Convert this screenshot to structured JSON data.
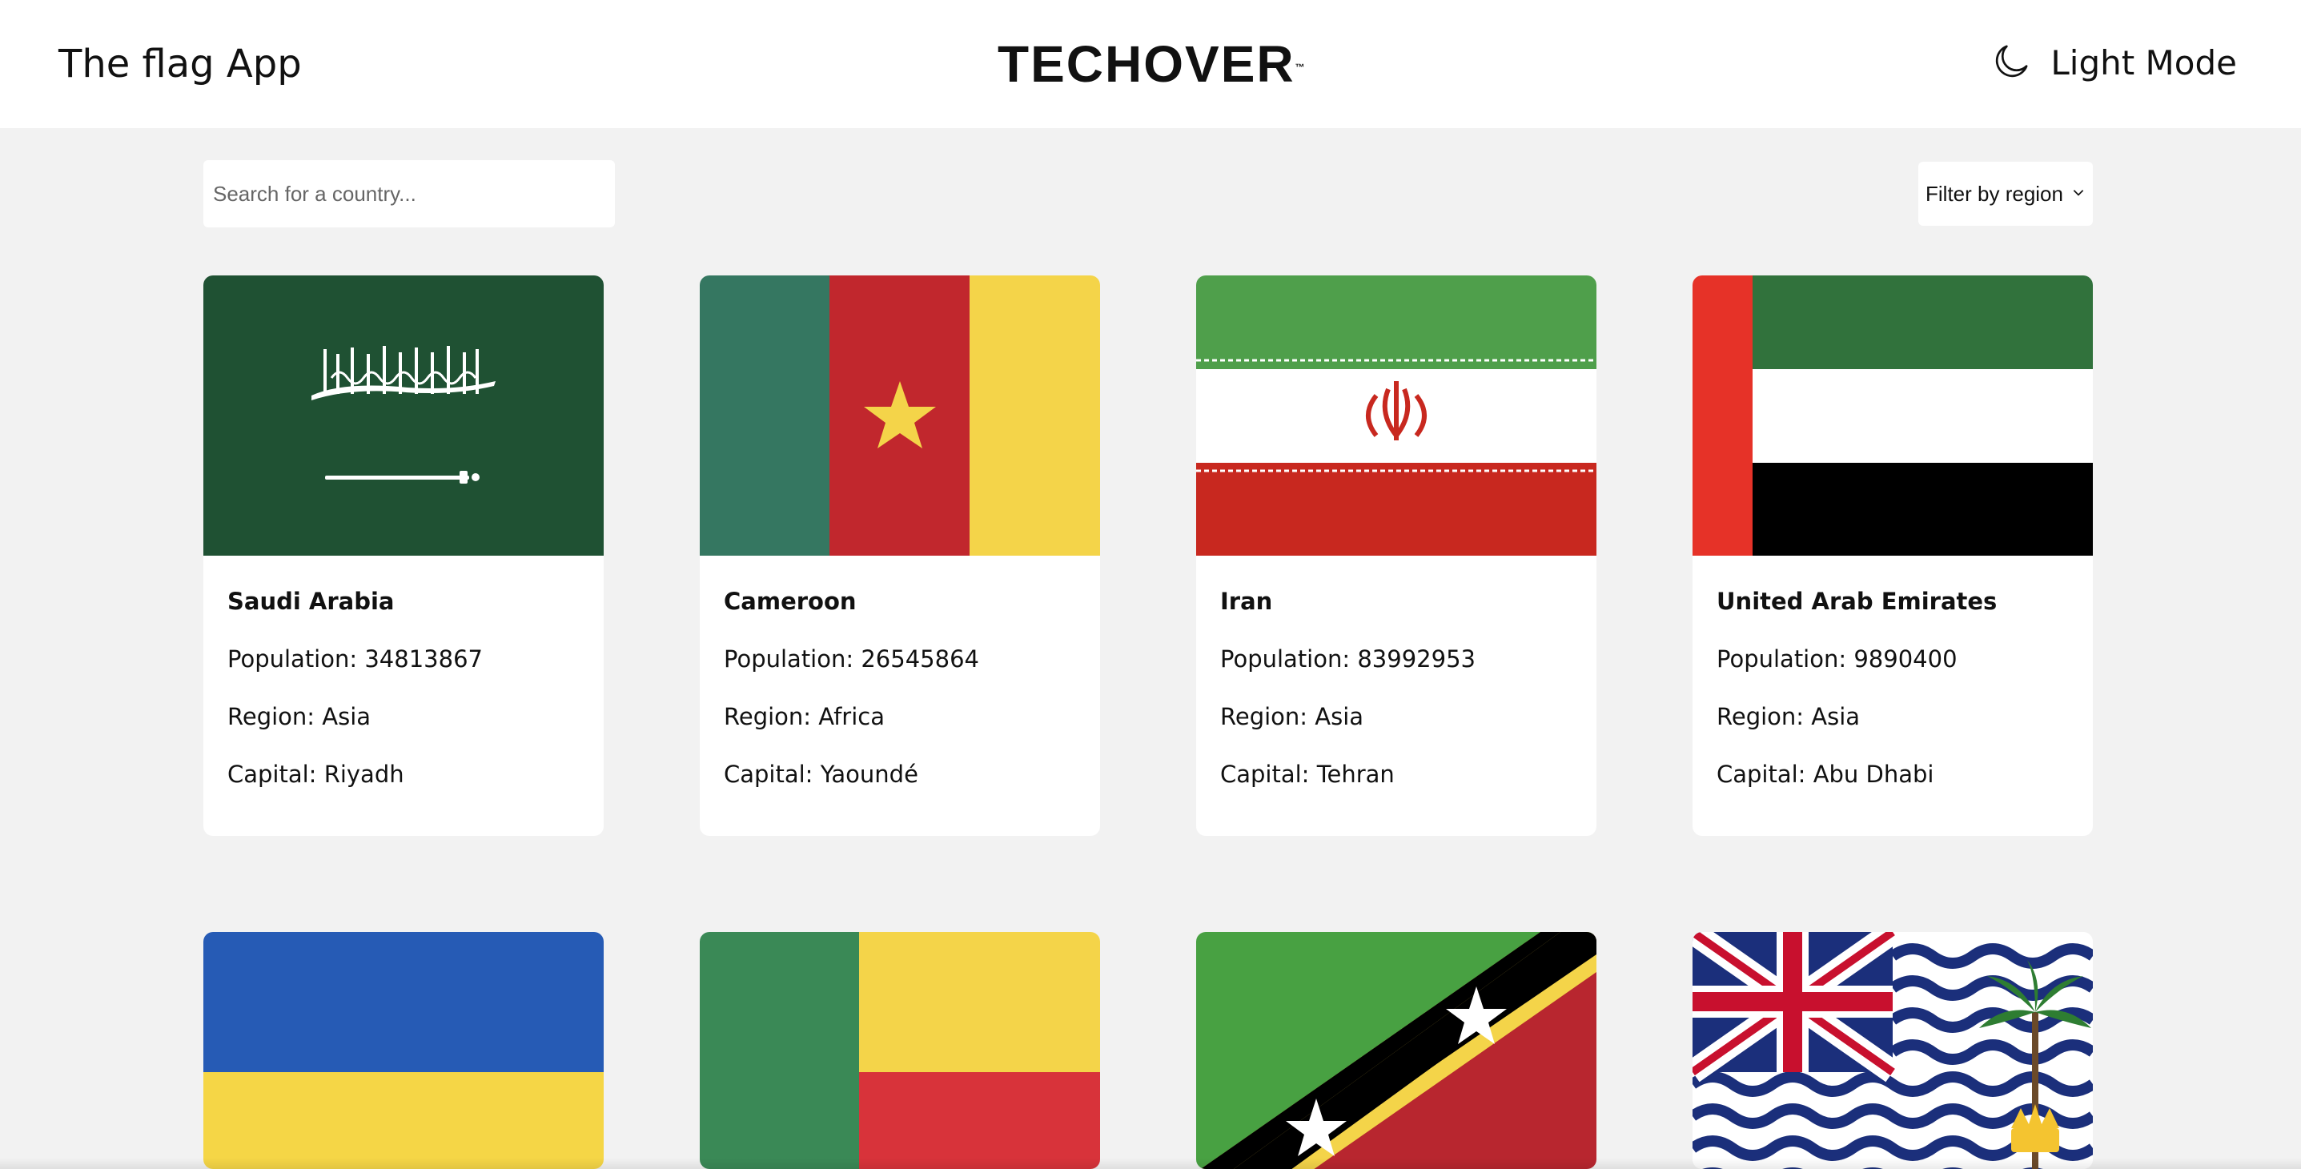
{
  "header": {
    "title": "The flag App",
    "logo": "TECHOVER",
    "logo_tm": "™",
    "theme_label": "Light Mode",
    "theme_icon": "moon-icon"
  },
  "search": {
    "placeholder": "Search for a country...",
    "value": ""
  },
  "filter": {
    "label": "Filter by region",
    "icon": "chevron-down-icon"
  },
  "labels": {
    "population": "Population:",
    "region": "Region:",
    "capital": "Capital:"
  },
  "countries": [
    {
      "name": "Saudi Arabia",
      "population": "34813867",
      "region": "Asia",
      "capital": "Riyadh",
      "flag": "saudi-arabia-flag"
    },
    {
      "name": "Cameroon",
      "population": "26545864",
      "region": "Africa",
      "capital": "Yaoundé",
      "flag": "cameroon-flag"
    },
    {
      "name": "Iran",
      "population": "83992953",
      "region": "Asia",
      "capital": "Tehran",
      "flag": "iran-flag"
    },
    {
      "name": "United Arab Emirates",
      "population": "9890400",
      "region": "Asia",
      "capital": "Abu Dhabi",
      "flag": "uae-flag"
    }
  ],
  "partial_cards": [
    {
      "flag": "ukraine-flag"
    },
    {
      "flag": "benin-flag"
    },
    {
      "flag": "saint-kitts-and-nevis-flag"
    },
    {
      "flag": "british-indian-ocean-territory-flag"
    }
  ],
  "colors": {
    "background": "#f2f2f2",
    "card": "#ffffff",
    "text": "#111111"
  }
}
